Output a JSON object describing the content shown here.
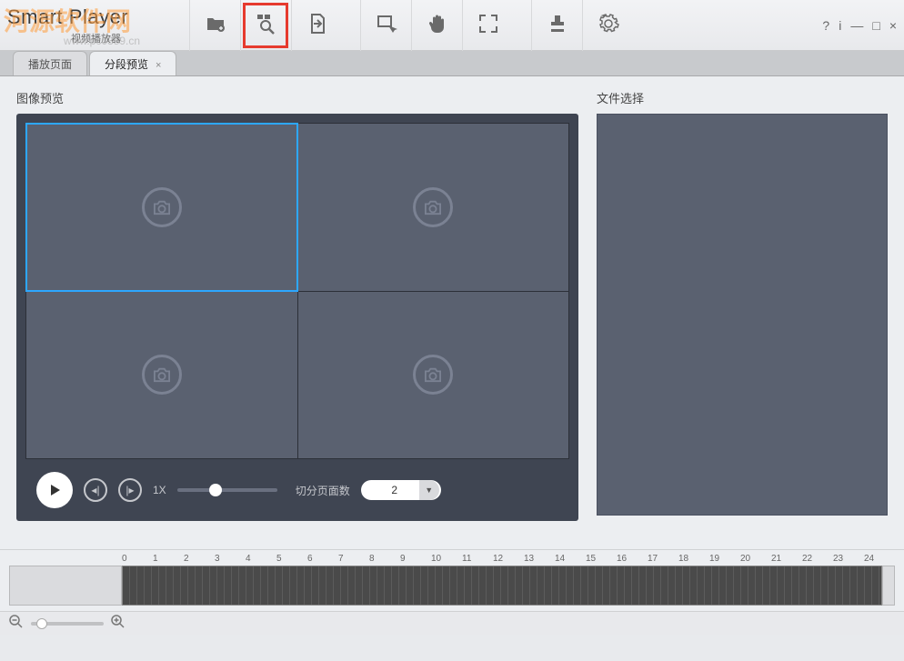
{
  "app": {
    "title": "Smart Player",
    "subtitle": "视频播放器",
    "watermark_text": "河源软件网",
    "watermark_url": "www.pc0359.cn"
  },
  "window_controls": {
    "help": "?",
    "info": "i",
    "minimize": "—",
    "maximize": "□",
    "close": "×"
  },
  "toolbar": {
    "items": [
      {
        "name": "open-folder",
        "icon": "folder-plus"
      },
      {
        "name": "segment-search",
        "icon": "grid-search",
        "highlighted": true
      },
      {
        "name": "export",
        "icon": "file-export"
      },
      {
        "name": "select-area",
        "icon": "rect-cursor"
      },
      {
        "name": "pan",
        "icon": "hand"
      },
      {
        "name": "fullscreen",
        "icon": "expand"
      },
      {
        "name": "snapshot",
        "icon": "stamp"
      },
      {
        "name": "settings",
        "icon": "gear"
      }
    ]
  },
  "tabs": [
    {
      "label": "播放页面",
      "active": false,
      "closable": false
    },
    {
      "label": "分段预览",
      "active": true,
      "closable": true
    }
  ],
  "preview": {
    "section_label": "图像预览",
    "cells": [
      {
        "selected": true
      },
      {
        "selected": false
      },
      {
        "selected": false
      },
      {
        "selected": false
      }
    ],
    "controls": {
      "speed_label": "1X",
      "split_label": "切分页面数",
      "split_value": "2"
    }
  },
  "file_panel": {
    "label": "文件选择"
  },
  "timeline": {
    "ticks": [
      "0",
      "1",
      "2",
      "3",
      "4",
      "5",
      "6",
      "7",
      "8",
      "9",
      "10",
      "11",
      "12",
      "13",
      "14",
      "15",
      "16",
      "17",
      "18",
      "19",
      "20",
      "21",
      "22",
      "23",
      "24"
    ]
  }
}
